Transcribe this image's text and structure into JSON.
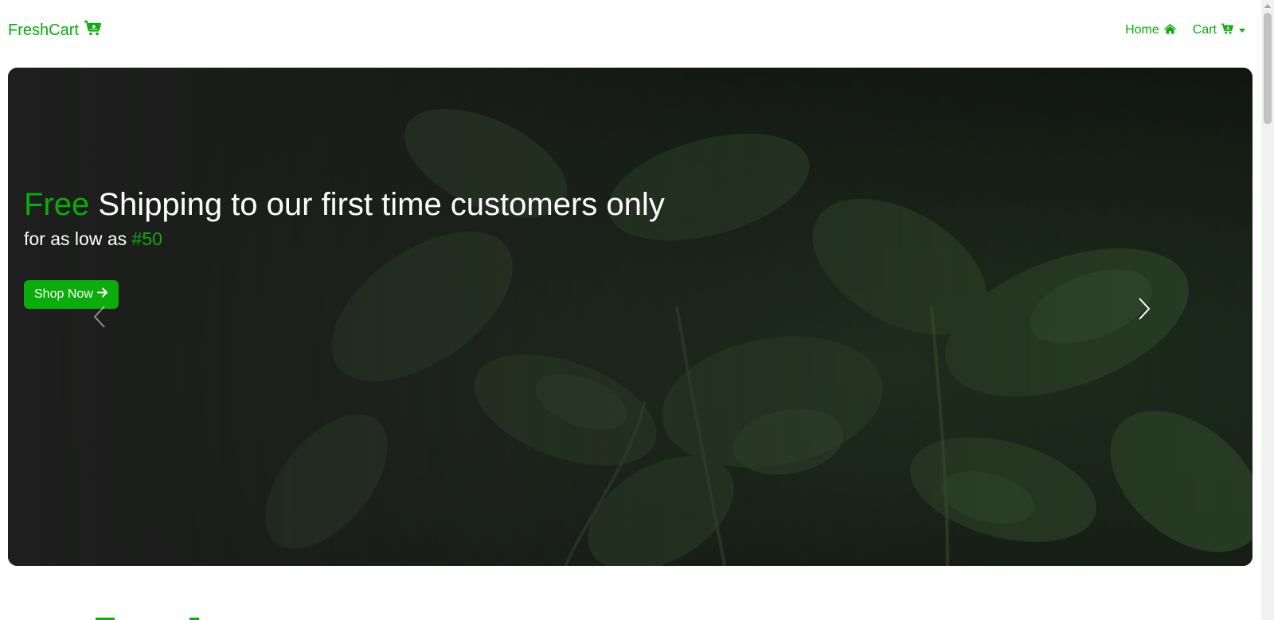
{
  "navbar": {
    "brand": "FreshCart",
    "links": [
      {
        "label": "Home",
        "icon": "home-icon"
      },
      {
        "label": "Cart",
        "icon": "cart-icon"
      }
    ]
  },
  "hero": {
    "title_accent": "Free",
    "title_rest": "Shipping to our first time customers only",
    "subtitle_prefix": "for as low as",
    "subtitle_accent": "#50",
    "button_label": "Shop Now"
  },
  "colors": {
    "accent": "#0aad0a",
    "text_light": "#ffffff"
  }
}
